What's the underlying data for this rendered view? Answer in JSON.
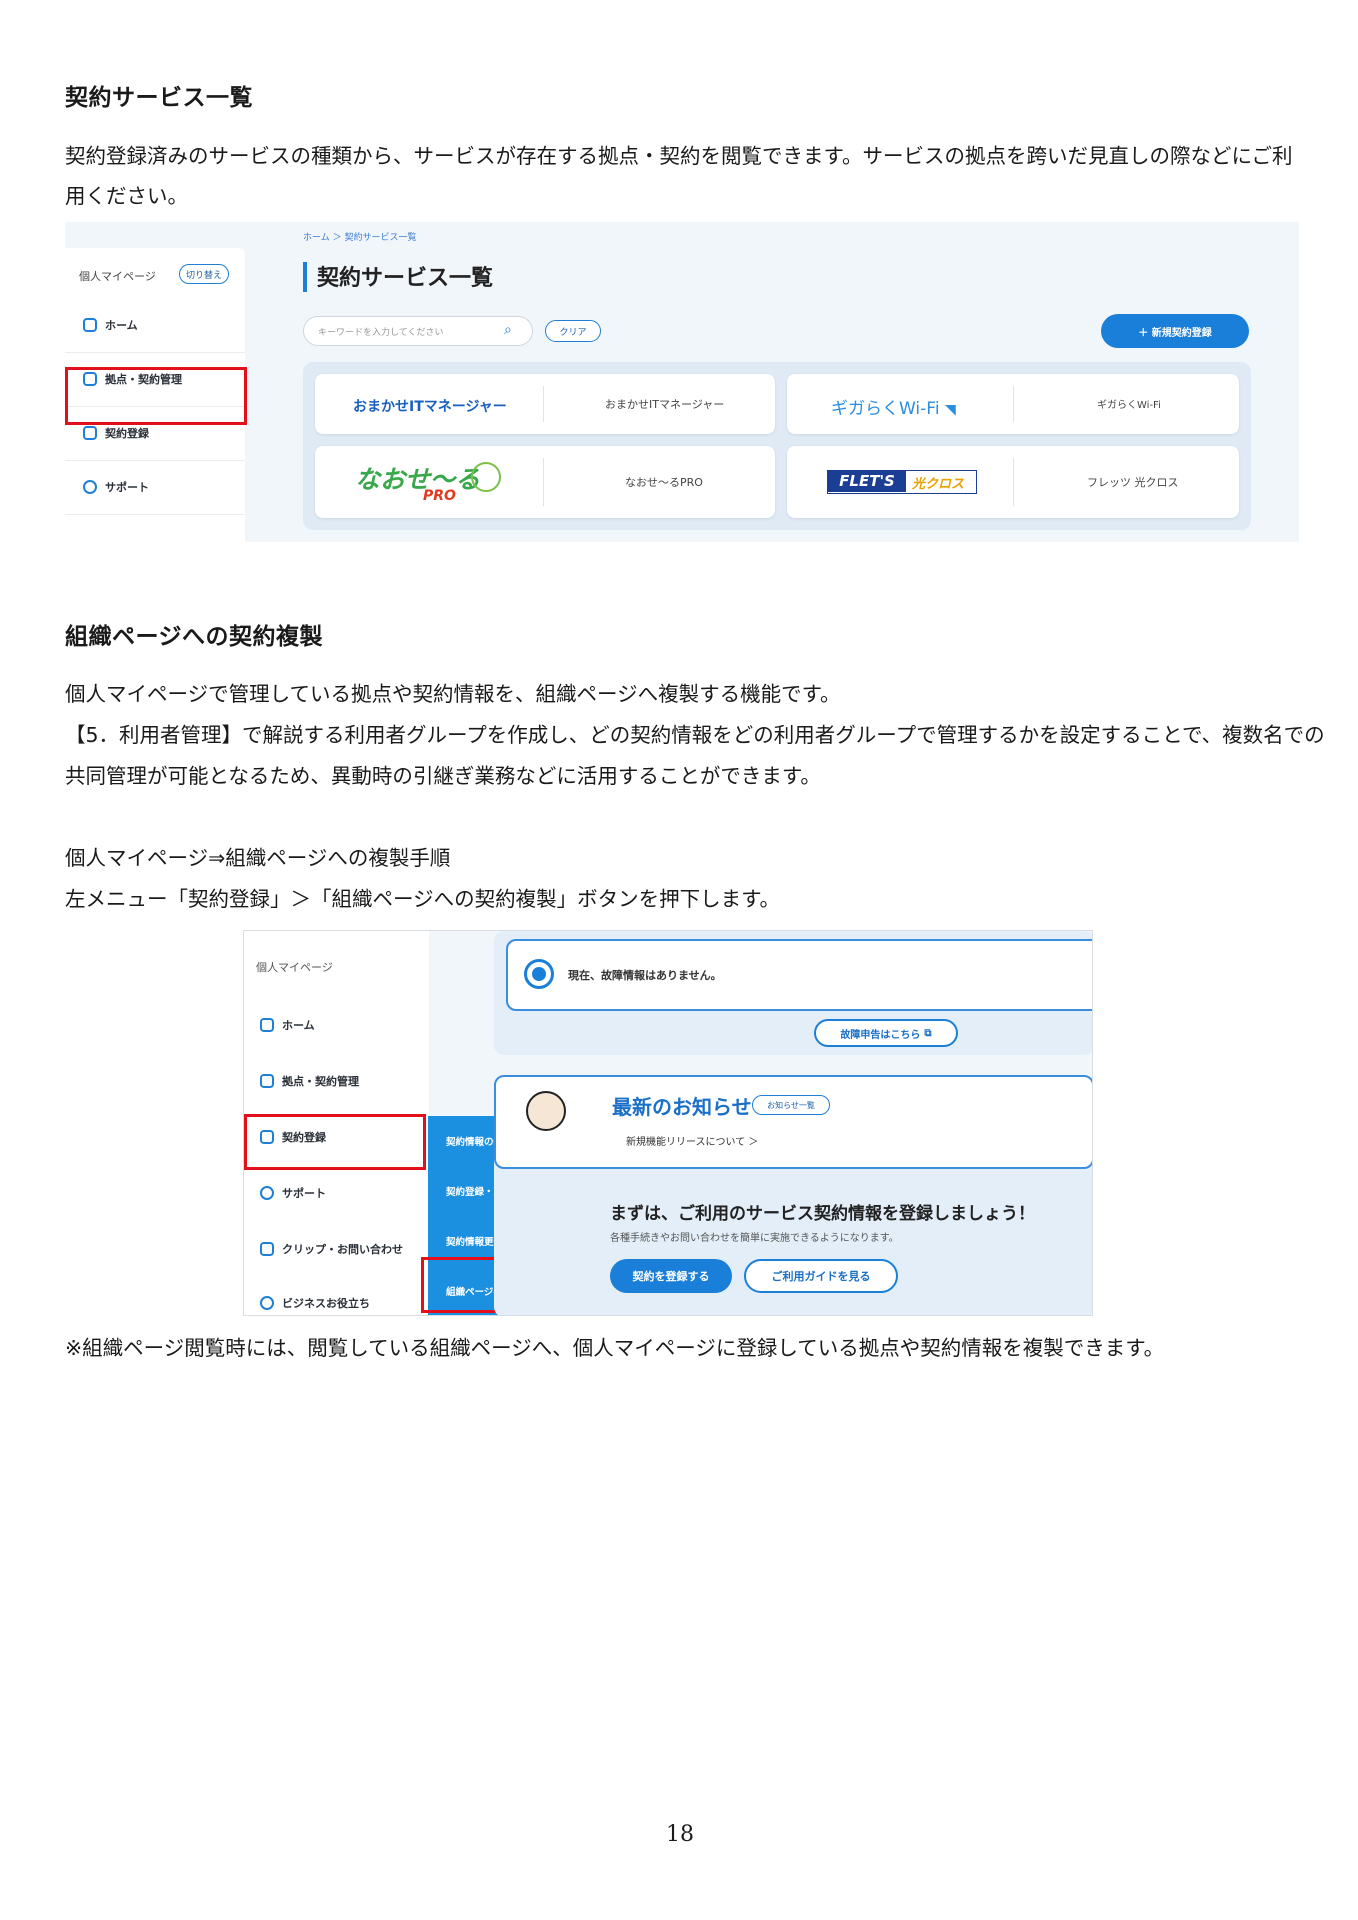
{
  "section1": {
    "heading": "契約サービス一覧",
    "para_line1": "契約登録済みのサービスの種類から、サービスが存在する拠点・契約を閲覧できます。サービスの拠点を跨いだ見直しの際などにご利",
    "para_line2": "用ください。"
  },
  "screenshot1": {
    "breadcrumb": "ホーム ＞ 契約サービス一覧",
    "sidebar_title": "個人マイページ",
    "switch_label": "切り替え",
    "sidebar_items": [
      "ホーム",
      "拠点・契約管理",
      "契約登録",
      "サポート"
    ],
    "page_title": "契約サービス一覧",
    "search_placeholder": "キーワードを入力してください",
    "clear_label": "クリア",
    "new_contract_label": "＋  新規契約登録",
    "services": [
      {
        "logo": "おまかせITマネージャー",
        "name": "おまかせITマネージャー"
      },
      {
        "logo": "ギガらくWi-Fi",
        "name": "ギガらくWi-Fi"
      },
      {
        "logo": "なおせ～る",
        "logo_sub": "PRO",
        "name": "なおせ～るPRO"
      },
      {
        "logo": "FLET'S",
        "logo_sub": "光クロス",
        "name": "フレッツ 光クロス"
      }
    ]
  },
  "section2": {
    "heading": "組織ページへの契約複製",
    "para_line1": "個人マイページで管理している拠点や契約情報を、組織ページへ複製する機能です。",
    "para_line2": "【5．利用者管理】で解説する利用者グループを作成し、どの契約情報をどの利用者グループで管理するかを設定することで、複数名での",
    "para_line3": "共同管理が可能となるため、異動時の引継ぎ業務などに活用することができます。",
    "steps_title": "個人マイページ⇒組織ページへの複製手順",
    "steps_text": "左メニュー「契約登録」＞「組織ページへの契約複製」ボタンを押下します。"
  },
  "screenshot2": {
    "sidebar_title": "個人マイページ",
    "sidebar_items": [
      "ホーム",
      "拠点・契約管理",
      "契約登録",
      "サポート",
      "クリップ・お問い合わせ",
      "ビジネスお役立ち"
    ],
    "submenu_items": [
      "契約情報の新規登録",
      "契約登録・更新状況",
      "契約情報更新",
      "組織ページへの契約複製"
    ],
    "status_text": "現在、故障情報はありません。",
    "fault_button": "故障申告はこちら",
    "news_title": "最新のお知らせ",
    "news_badge": "お知らせ一覧",
    "news_item": "新規機能リリースについて ＞",
    "register_heading": "まずは、ご利用のサービス契約情報を登録しましょう！",
    "register_sub": "各種手続きやお問い合わせを簡単に実施できるようになります。",
    "register_button": "契約を登録する",
    "guide_button": "ご利用ガイドを見る"
  },
  "note": "※組織ページ閲覧時には、閲覧している組織ページへ、個人マイページに登録している拠点や契約情報を複製できます。",
  "page_number": "18",
  "colors": {
    "accent": "#1a7fd8",
    "highlight": "#e3101b",
    "menu": "#1b8fe0"
  }
}
